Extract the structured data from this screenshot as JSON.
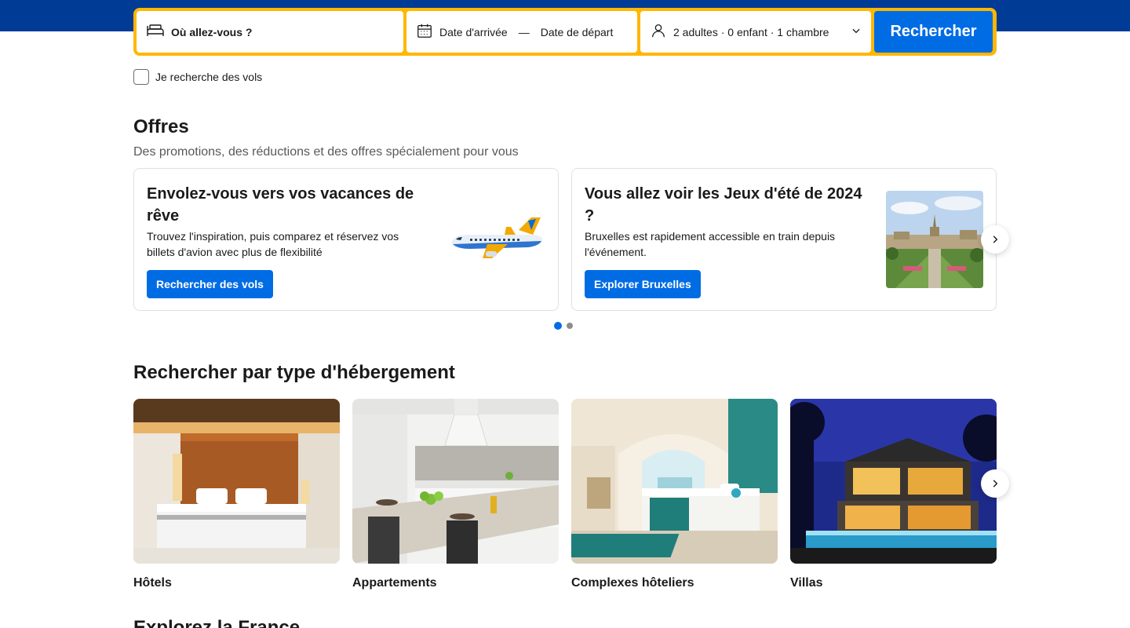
{
  "search": {
    "destination_placeholder": "Où allez-vous ?",
    "checkin_label": "Date d'arrivée",
    "date_separator": "—",
    "checkout_label": "Date de départ",
    "guests_summary": "2 adultes · 0 enfant · 1 chambre",
    "submit_label": "Rechercher",
    "flights_checkbox_label": "Je recherche des vols",
    "flights_checked": false
  },
  "offers": {
    "title": "Offres",
    "subtitle": "Des promotions, des réductions et des offres spécialement pour vous",
    "cards": [
      {
        "title": "Envolez-vous vers vos vacances de rêve",
        "text": "Trouvez l'inspiration, puis comparez et réservez vos billets d'avion avec plus de flexibilité",
        "cta": "Rechercher des vols",
        "image_icon": "airplane-illustration"
      },
      {
        "title": "Vous allez voir les Jeux d'été de 2024 ?",
        "text": "Bruxelles est rapidement accessible en train depuis l'événement.",
        "cta": "Explorer Bruxelles",
        "image_icon": "brussels-photo"
      }
    ],
    "pagination": {
      "current": 1,
      "total": 2
    }
  },
  "property_types": {
    "title": "Rechercher par type d'hébergement",
    "items": [
      {
        "label": "Hôtels",
        "image_icon": "hotel-room-photo"
      },
      {
        "label": "Appartements",
        "image_icon": "apartment-kitchen-photo"
      },
      {
        "label": "Complexes hôteliers",
        "image_icon": "resort-room-photo"
      },
      {
        "label": "Villas",
        "image_icon": "villa-pool-photo"
      }
    ]
  },
  "explore": {
    "title": "Explorez la France"
  },
  "colors": {
    "brand_blue": "#003b95",
    "action_blue": "#006ce4",
    "search_border_yellow": "#ffb700"
  }
}
